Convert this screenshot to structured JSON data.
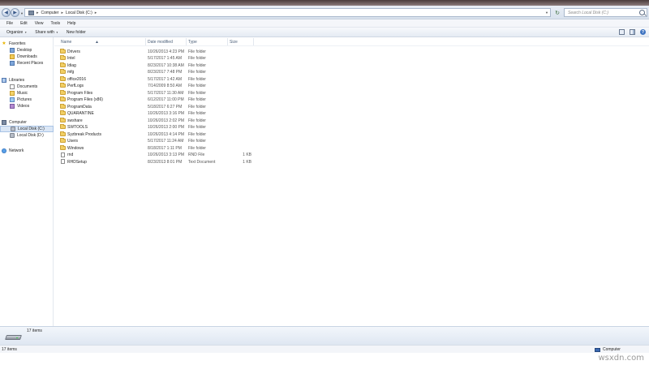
{
  "address_bar": {
    "crumbs": [
      "Computer",
      "Local Disk (C:)"
    ],
    "search_placeholder": "Search Local Disk (C:)"
  },
  "menu": [
    "File",
    "Edit",
    "View",
    "Tools",
    "Help"
  ],
  "commands": {
    "organize": "Organize",
    "share_with": "Share with",
    "new_folder": "New folder"
  },
  "nav_pane": {
    "favorites": {
      "label": "Favorites",
      "items": [
        "Desktop",
        "Downloads",
        "Recent Places"
      ]
    },
    "libraries": {
      "label": "Libraries",
      "items": [
        "Documents",
        "Music",
        "Pictures",
        "Videos"
      ]
    },
    "computer": {
      "label": "Computer",
      "items": [
        "Local Disk (C:)",
        "Local Disk (D:)"
      ]
    },
    "network": {
      "label": "Network"
    }
  },
  "columns": {
    "name": "Name",
    "date": "Date modified",
    "type": "Type",
    "size": "Size"
  },
  "files": [
    {
      "name": "Drivers",
      "date": "10/26/2013 4:23 PM",
      "type": "File folder",
      "size": "",
      "kind": "folder"
    },
    {
      "name": "Intel",
      "date": "5/17/2017 1:45 AM",
      "type": "File folder",
      "size": "",
      "kind": "folder"
    },
    {
      "name": "Idiag",
      "date": "8/23/2017 10:38 AM",
      "type": "File folder",
      "size": "",
      "kind": "folder"
    },
    {
      "name": "mfg",
      "date": "8/23/2017 7:48 PM",
      "type": "File folder",
      "size": "",
      "kind": "folder"
    },
    {
      "name": "office2016",
      "date": "5/17/2017 1:42 AM",
      "type": "File folder",
      "size": "",
      "kind": "folder"
    },
    {
      "name": "PerfLogs",
      "date": "7/14/2009 8:50 AM",
      "type": "File folder",
      "size": "",
      "kind": "folder"
    },
    {
      "name": "Program Files",
      "date": "5/17/2017 11:30 AM",
      "type": "File folder",
      "size": "",
      "kind": "folder"
    },
    {
      "name": "Program Files (x86)",
      "date": "6/12/2017 11:00 PM",
      "type": "File folder",
      "size": "",
      "kind": "folder"
    },
    {
      "name": "ProgramData",
      "date": "5/18/2017 6:27 PM",
      "type": "File folder",
      "size": "",
      "kind": "folder"
    },
    {
      "name": "QUARANTINE",
      "date": "10/26/2013 3:16 PM",
      "type": "File folder",
      "size": "",
      "kind": "folder"
    },
    {
      "name": "swshare",
      "date": "10/26/2013 2:02 PM",
      "type": "File folder",
      "size": "",
      "kind": "folder"
    },
    {
      "name": "SWTOOLS",
      "date": "10/26/2013 2:00 PM",
      "type": "File folder",
      "size": "",
      "kind": "folder"
    },
    {
      "name": "Syzbreak Products",
      "date": "10/26/2013 4:14 PM",
      "type": "File folder",
      "size": "",
      "kind": "folder"
    },
    {
      "name": "Users",
      "date": "5/17/2017 11:24 AM",
      "type": "File folder",
      "size": "",
      "kind": "folder"
    },
    {
      "name": "Windows",
      "date": "8/18/2017 1:11 PM",
      "type": "File folder",
      "size": "",
      "kind": "folder"
    },
    {
      "name": "rnd",
      "date": "10/26/2013 3:13 PM",
      "type": "RND File",
      "size": "1 KB",
      "kind": "file"
    },
    {
      "name": "RHDSetup",
      "date": "8/23/2013 8:01 PM",
      "type": "Text Document",
      "size": "1 KB",
      "kind": "file"
    }
  ],
  "details": {
    "items_count": "17 items"
  },
  "status_bar": {
    "left": "17 items",
    "right": "Computer"
  },
  "watermark": "wsxdn.com",
  "colors": {
    "folder": "#f1ce63",
    "selection": "#dbe7f6",
    "toolbar": "#e5ebf3"
  }
}
